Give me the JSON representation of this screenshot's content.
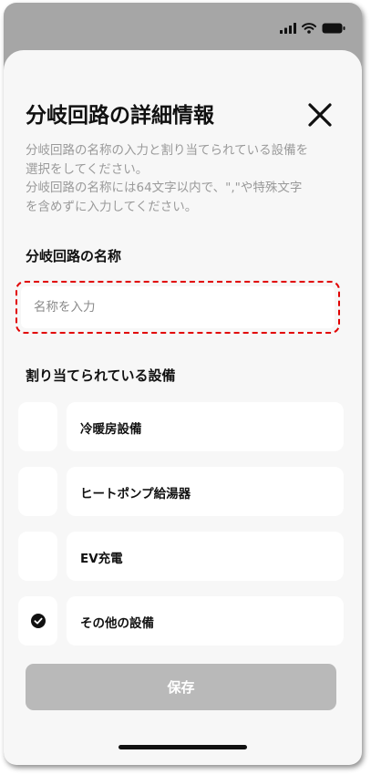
{
  "status_bar": {
    "icons": [
      "signal-icon",
      "wifi-icon",
      "battery-icon"
    ]
  },
  "modal": {
    "title": "分岐回路の詳細情報",
    "close_icon": "close-icon",
    "description": [
      "分岐回路の名称の入力と割り当てられている設備を",
      "選択をしてください。",
      "分岐回路の名称には64文字以内で、\",\"や特殊文字",
      "を含めずに入力してください。"
    ]
  },
  "name_field": {
    "label": "分岐回路の名称",
    "placeholder": "名称を入力",
    "value": "",
    "highlight_color": "#e10000"
  },
  "equipment": {
    "label": "割り当てられている設備",
    "items": [
      {
        "label": "冷暖房設備",
        "checked": false
      },
      {
        "label": "ヒートポンプ給湯器",
        "checked": false
      },
      {
        "label": "EV充電",
        "checked": false
      },
      {
        "label": "その他の設備",
        "checked": true
      }
    ]
  },
  "save_button": {
    "label": "保存",
    "enabled": false,
    "color": "#b9b9b9"
  }
}
